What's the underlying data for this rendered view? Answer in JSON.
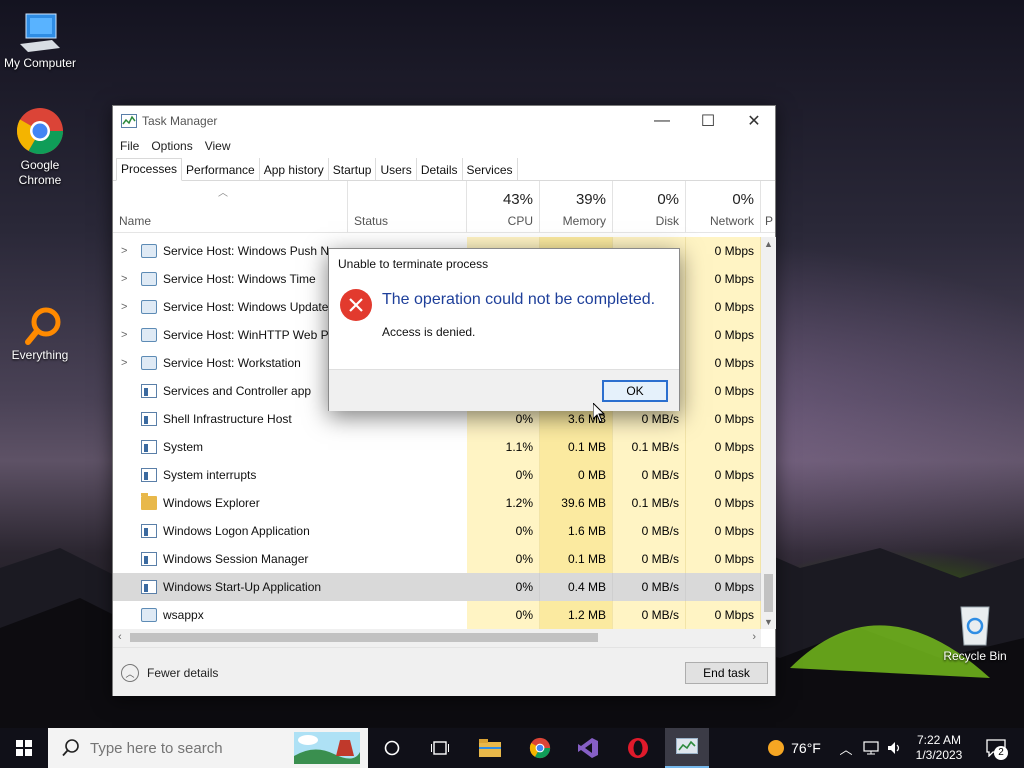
{
  "desktop": {
    "icons": [
      {
        "label": "My Computer"
      },
      {
        "label": "Google Chrome"
      },
      {
        "label": "Everything"
      },
      {
        "label": "Recycle Bin"
      }
    ]
  },
  "task_manager": {
    "title": "Task Manager",
    "window_controls": {
      "minimize": "—",
      "maximize": "☐",
      "close": "✕"
    },
    "menu": [
      "File",
      "Options",
      "View"
    ],
    "tabs": [
      "Processes",
      "Performance",
      "App history",
      "Startup",
      "Users",
      "Details",
      "Services"
    ],
    "active_tab": "Processes",
    "columns": {
      "name": "Name",
      "status": "Status",
      "cpu": {
        "percent": "43%",
        "label": "CPU"
      },
      "memory": {
        "percent": "39%",
        "label": "Memory"
      },
      "disk": {
        "percent": "0%",
        "label": "Disk"
      },
      "network": {
        "percent": "0%",
        "label": "Network"
      },
      "power_partial": "P"
    },
    "rows": [
      {
        "name": "Service Host: Windows Push No",
        "expand": true,
        "icon": "gear",
        "cpu": "",
        "mem": "",
        "disk": "",
        "net": "0 Mbps"
      },
      {
        "name": "Service Host: Windows Time",
        "expand": true,
        "icon": "gear",
        "cpu": "",
        "mem": "",
        "disk": "",
        "net": "0 Mbps"
      },
      {
        "name": "Service Host: Windows Update",
        "expand": true,
        "icon": "gear",
        "cpu": "",
        "mem": "",
        "disk": "",
        "net": "0 Mbps"
      },
      {
        "name": "Service Host: WinHTTP Web Pro",
        "expand": true,
        "icon": "gear",
        "cpu": "",
        "mem": "",
        "disk": "",
        "net": "0 Mbps"
      },
      {
        "name": "Service Host: Workstation",
        "expand": true,
        "icon": "gear",
        "cpu": "",
        "mem": "",
        "disk": "",
        "net": "0 Mbps"
      },
      {
        "name": "Services and Controller app",
        "expand": false,
        "icon": "win",
        "cpu": "",
        "mem": "",
        "disk": "",
        "net": "0 Mbps"
      },
      {
        "name": "Shell Infrastructure Host",
        "expand": false,
        "icon": "win",
        "cpu": "0%",
        "mem": "3.6 MB",
        "disk": "0 MB/s",
        "net": "0 Mbps"
      },
      {
        "name": "System",
        "expand": false,
        "icon": "win",
        "cpu": "1.1%",
        "mem": "0.1 MB",
        "disk": "0.1 MB/s",
        "net": "0 Mbps"
      },
      {
        "name": "System interrupts",
        "expand": false,
        "icon": "win",
        "cpu": "0%",
        "mem": "0 MB",
        "disk": "0 MB/s",
        "net": "0 Mbps"
      },
      {
        "name": "Windows Explorer",
        "expand": false,
        "icon": "folder",
        "cpu": "1.2%",
        "mem": "39.6 MB",
        "disk": "0.1 MB/s",
        "net": "0 Mbps"
      },
      {
        "name": "Windows Logon Application",
        "expand": false,
        "icon": "win",
        "cpu": "0%",
        "mem": "1.6 MB",
        "disk": "0 MB/s",
        "net": "0 Mbps"
      },
      {
        "name": "Windows Session Manager",
        "expand": false,
        "icon": "win",
        "cpu": "0%",
        "mem": "0.1 MB",
        "disk": "0 MB/s",
        "net": "0 Mbps"
      },
      {
        "name": "Windows Start-Up Application",
        "expand": false,
        "icon": "win",
        "cpu": "0%",
        "mem": "0.4 MB",
        "disk": "0 MB/s",
        "net": "0 Mbps",
        "selected": true
      },
      {
        "name": "wsappx",
        "expand": false,
        "icon": "gear",
        "cpu": "0%",
        "mem": "1.2 MB",
        "disk": "0 MB/s",
        "net": "0 Mbps"
      }
    ],
    "footer": {
      "fewer_details": "Fewer details",
      "end_task": "End task"
    }
  },
  "error_dialog": {
    "title": "Unable to terminate process",
    "message": "The operation could not be completed.",
    "detail": "Access is denied.",
    "ok_label": "OK"
  },
  "taskbar": {
    "search_placeholder": "Type here to search",
    "weather": "76°F",
    "time": "7:22 AM",
    "date": "1/3/2023",
    "notification_count": "2"
  },
  "colors": {
    "accent": "#2b6fcf",
    "error_icon": "#e23a2e",
    "dialog_heading": "#1e3f9a",
    "heat_light": "#fff4c4",
    "heat_memory": "#fbeaa0"
  }
}
